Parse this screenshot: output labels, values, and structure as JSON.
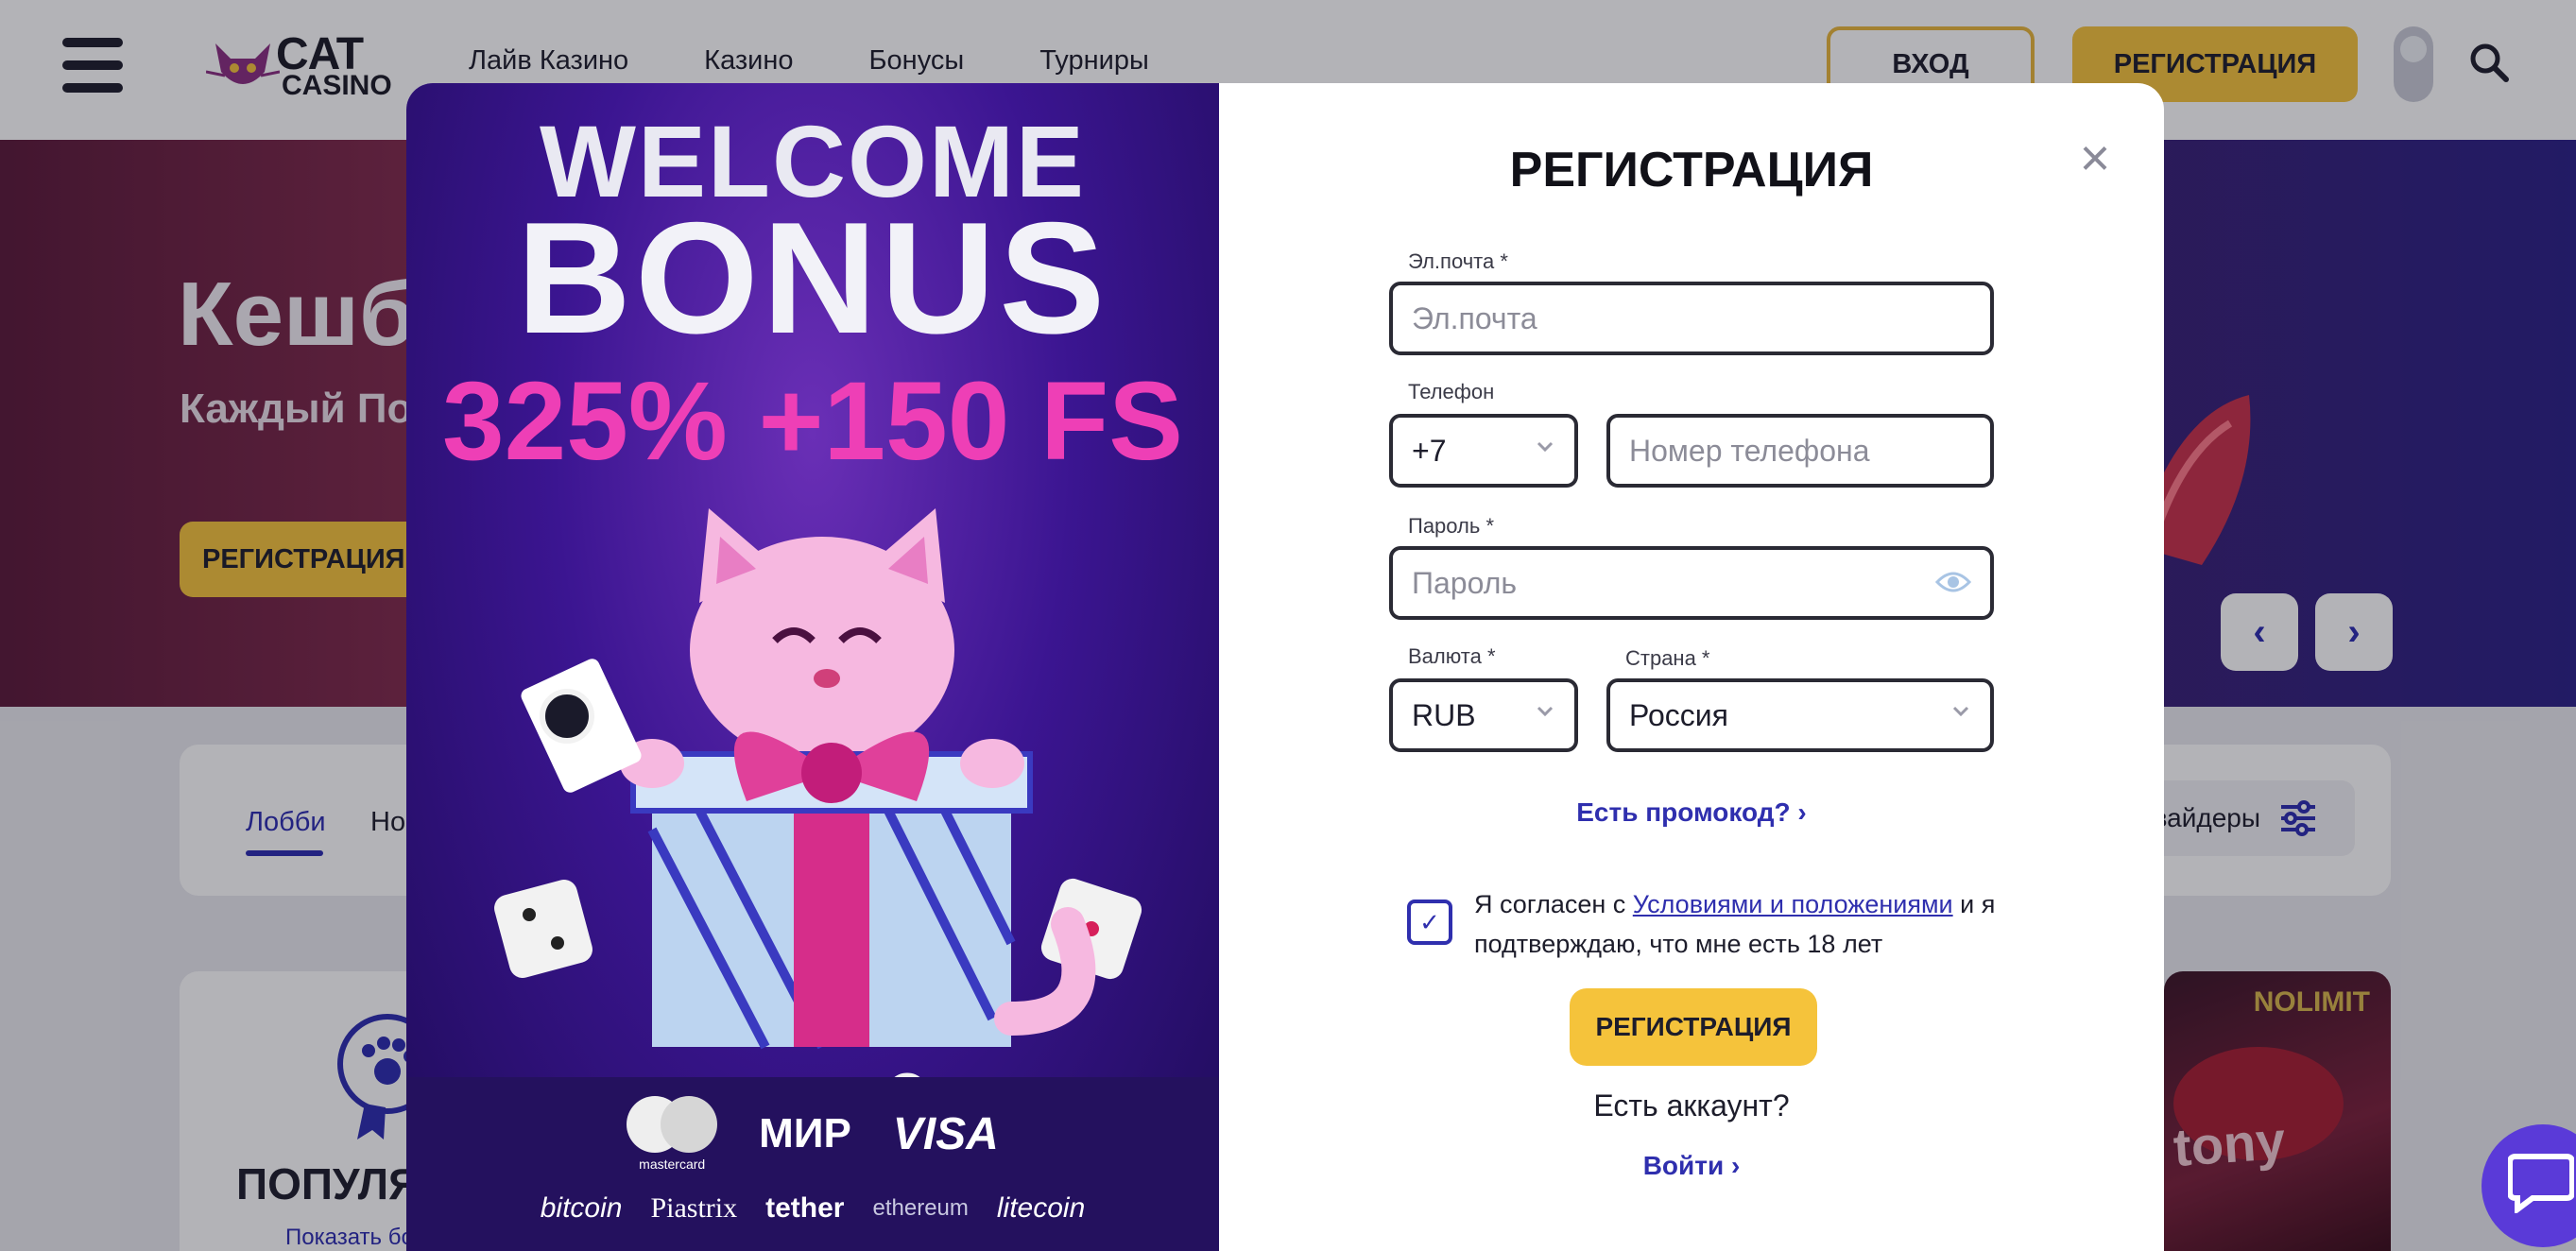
{
  "header": {
    "logo_line1": "CAT",
    "logo_line2": "CASINO",
    "nav": [
      "Лайв Казино",
      "Казино",
      "Бонусы",
      "Турниры"
    ],
    "login_label": "ВХОД",
    "register_label": "РЕГИСТРАЦИЯ"
  },
  "hero": {
    "title": "Кешб",
    "subtitle": "Каждый По",
    "button_label": "РЕГИСТРАЦИЯ",
    "prev_arrow": "‹",
    "next_arrow": "›"
  },
  "lobby": {
    "tab_active": "Лобби",
    "tab_second": "Но",
    "providers_label": "овайдеры"
  },
  "games": {
    "popular_title": "ПОПУЛЯ",
    "popular_link": "Показать бо",
    "game_provider": "NOLIMIT",
    "game_name": "tony"
  },
  "promo": {
    "line1": "WELCOME",
    "line2": "BONUS",
    "amount": "325% +150 FS",
    "payments_row1": [
      "mastercard",
      "МИР",
      "VISA"
    ],
    "payments_row2": [
      "bitcoin",
      "Piastrix",
      "tether",
      "ethereum",
      "litecoin"
    ]
  },
  "form": {
    "close": "×",
    "title": "РЕГИСТРАЦИЯ",
    "email_label": "Эл.почта *",
    "email_placeholder": "Эл.почта",
    "phone_label": "Телефон",
    "phone_code": "+7",
    "phone_placeholder": "Номер телефона",
    "password_label": "Пароль *",
    "password_placeholder": "Пароль",
    "currency_label": "Валюта *",
    "currency_value": "RUB",
    "country_label": "Страна *",
    "country_value": "Россия",
    "promo_link": "Есть промокод? ›",
    "terms_prefix": "Я согласен с ",
    "terms_link": "Условиями и положениями",
    "terms_suffix": " и я подтверждаю, что мне есть 18 лет",
    "submit_label": "РЕГИСТРАЦИЯ",
    "have_account": "Есть аккаунт?",
    "login_link": "Войти ›",
    "terms_checked": true
  },
  "colors": {
    "accent_yellow": "#f5c33b",
    "accent_blue": "#2f2fae",
    "promo_pink": "#ee3fb6",
    "chat_purple": "#5a3ad8"
  }
}
